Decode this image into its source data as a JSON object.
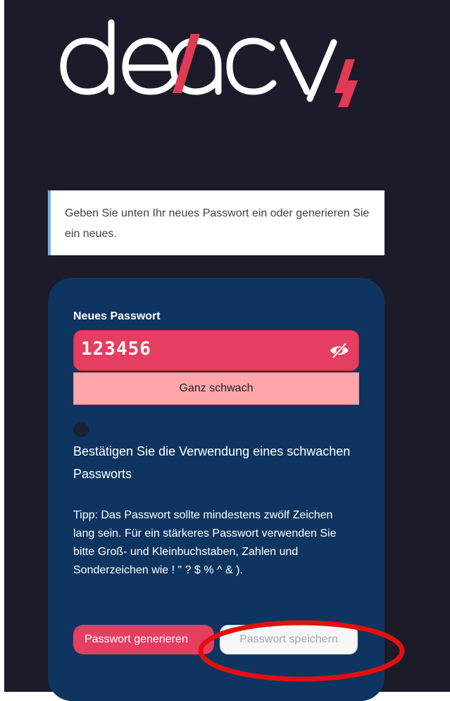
{
  "logo": {
    "text": "devacy"
  },
  "notice": {
    "text": "Geben Sie unten Ihr neues Passwort ein oder generieren Sie ein neues."
  },
  "form": {
    "new_password_label": "Neues Passwort",
    "password_value": "123456",
    "strength_label": "Ganz schwach",
    "confirm_weak_label": "Bestätigen Sie die Verwendung eines schwachen Passworts",
    "tip": "Tipp: Das Passwort sollte mindestens zwölf Zeichen lang sein. Für ein stärkeres Passwort verwenden Sie bitte Groß- und Kleinbuchstaben, Zahlen und Sonderzeichen wie ! \" ? $ % ^ & ).",
    "generate_button": "Passwort generieren",
    "save_button": "Passwort speichern"
  },
  "icons": {
    "visibility": "eye-slash-icon"
  },
  "colors": {
    "background": "#1c1b2a",
    "card": "#0e3560",
    "accent": "#e53e60",
    "strength_bg": "#ffa6ab",
    "notice_border": "#72aee6",
    "annotation": "#e01010"
  }
}
